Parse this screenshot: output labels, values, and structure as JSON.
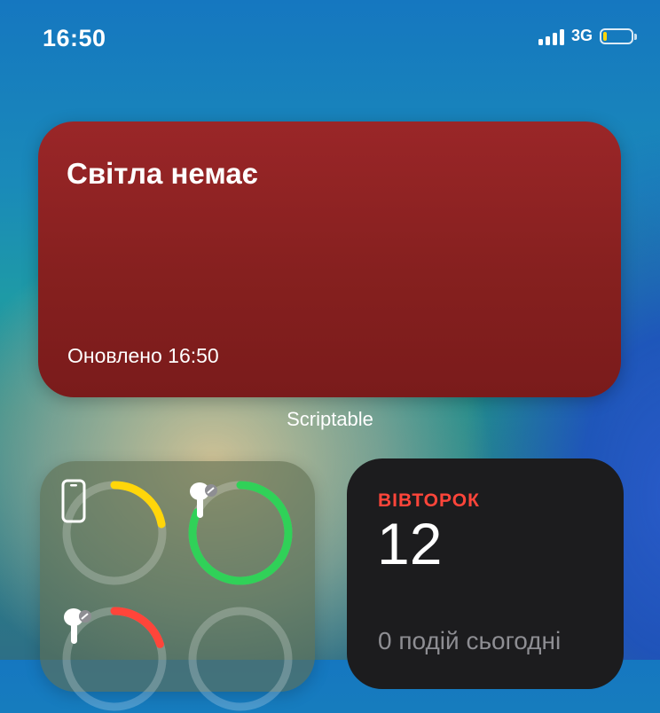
{
  "status_bar": {
    "time": "16:50",
    "network": "3G",
    "battery_level": 0.12,
    "battery_color": "#ffd60a"
  },
  "power_widget": {
    "title": "Світла немає",
    "updated": "Оновлено 16:50",
    "caption": "Scriptable",
    "background": "#8c2224"
  },
  "batteries_widget": {
    "devices": [
      {
        "icon": "iphone-icon",
        "level": 0.22,
        "color": "#ffd60a"
      },
      {
        "icon": "airpod-icon",
        "level": 0.82,
        "color": "#30d158"
      },
      {
        "icon": "airpod-icon",
        "level": 0.2,
        "color": "#ff453a"
      },
      {
        "icon": "empty-slot",
        "level": 0,
        "color": "#8e8e93"
      }
    ]
  },
  "calendar_widget": {
    "day": "ВІВТОРОК",
    "date": "12",
    "events": "0 подій сьогодні"
  }
}
